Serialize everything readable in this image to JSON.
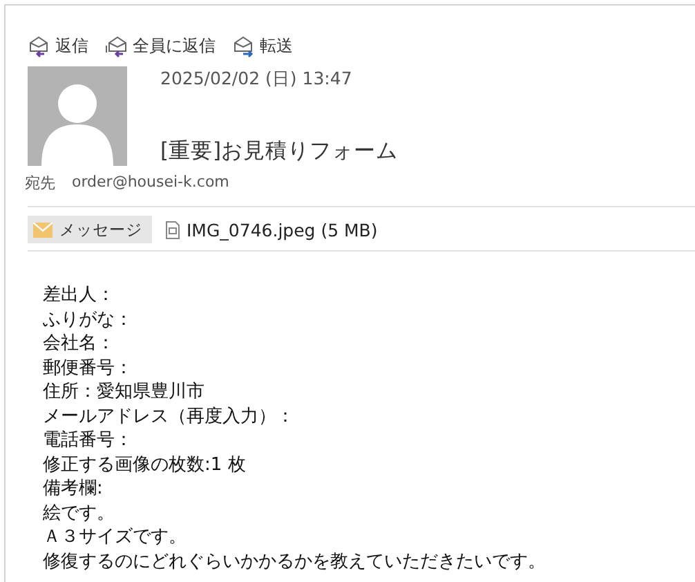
{
  "actions": [
    {
      "label": "返信",
      "kind": "reply"
    },
    {
      "label": "全員に返信",
      "kind": "reply_all"
    },
    {
      "label": "転送",
      "kind": "forward"
    }
  ],
  "message": {
    "date": "2025/02/02 (日) 13:47",
    "subject": "[重要]お見積りフォーム",
    "to_label": "宛先",
    "to": "order@housei-k.com"
  },
  "tabs": [
    {
      "label": "メッセージ",
      "kind": "message",
      "selected": true
    },
    {
      "label": "IMG_0746.jpeg (5 MB)",
      "kind": "file",
      "selected": false
    }
  ],
  "body": [
    "差出人：",
    "ふりがな：",
    "会社名：",
    "郵便番号：",
    "住所：愛知県豊川市",
    "メールアドレス（再度入力）：",
    "電話番号：",
    "修正する画像の枚数:1 枚",
    "備考欄:",
    "絵です。",
    "Ａ３サイズです。",
    "修復するのにどれぐらいかかるかを教えていただきたいです。"
  ]
}
